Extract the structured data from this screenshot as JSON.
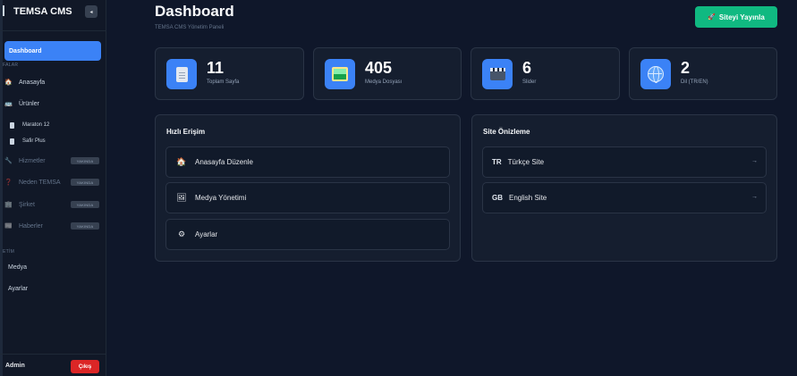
{
  "sidebar": {
    "title": "TEMSA CMS",
    "collapse_icon": "◂",
    "active_item": "Dashboard",
    "section_pages": "FALAR",
    "items": [
      {
        "label": "Anasayfa",
        "icon": "🏠"
      },
      {
        "label": "Ürünler",
        "icon": "🚌"
      }
    ],
    "sub_items": [
      {
        "label": "Maraton 12"
      },
      {
        "label": "Safir Plus"
      }
    ],
    "dim_items": [
      {
        "label": "Hizmetler",
        "icon": "🔧",
        "badge": "YAKINDA"
      },
      {
        "label": "Neden TEMSA",
        "icon": "❓",
        "badge": "YAKINDA"
      },
      {
        "label": "Şirket",
        "icon": "🏢",
        "badge": "YAKINDA"
      },
      {
        "label": "Haberler",
        "icon": "📰",
        "badge": "YAKINDA"
      }
    ],
    "section_manage": "ETİM",
    "manage_items": [
      {
        "label": "Medya"
      },
      {
        "label": "Ayarlar"
      }
    ],
    "user": "Admin",
    "logout_label": "Çıkış"
  },
  "header": {
    "title": "Dashboard",
    "subtitle": "TEMSA CMS Yönetim Paneli",
    "publish_icon": "🚀",
    "publish_label": "Siteyi Yayınla"
  },
  "stats": [
    {
      "value": "11",
      "label": "Toplam Sayfa",
      "icon": "document-icon"
    },
    {
      "value": "405",
      "label": "Medya Dosyası",
      "icon": "image-icon"
    },
    {
      "value": "6",
      "label": "Slider",
      "icon": "clapper-icon"
    },
    {
      "value": "2",
      "label": "Dil (TR/EN)",
      "icon": "globe-icon"
    }
  ],
  "quick_access": {
    "title": "Hızlı Erişim",
    "items": [
      {
        "label": "Anasayfa Düzenle",
        "icon": "🏠"
      },
      {
        "label": "Medya Yönetimi",
        "icon": "🖼"
      },
      {
        "label": "Ayarlar",
        "icon": "⚙"
      }
    ]
  },
  "site_preview": {
    "title": "Site Önizleme",
    "items": [
      {
        "code": "TR",
        "label": "Türkçe Site",
        "more": "→"
      },
      {
        "code": "GB",
        "label": "English Site",
        "more": "→"
      }
    ]
  },
  "colors": {
    "background": "#0f172a",
    "accent": "#3b82f6",
    "publish": "#10b981",
    "logout": "#dc2626"
  }
}
